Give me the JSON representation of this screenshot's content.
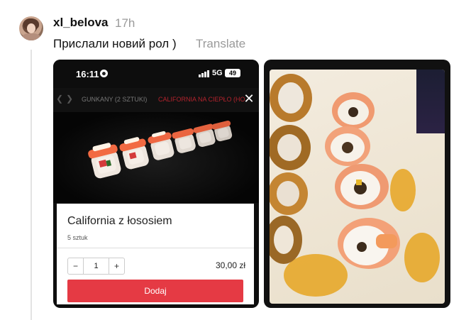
{
  "post": {
    "username": "xl_belova",
    "time": "17h",
    "caption": "Прислали новий рол )",
    "translate_label": "Translate"
  },
  "phone_screenshot": {
    "status_time": "16:11",
    "network": "5G",
    "battery": "49",
    "tabs": [
      "GUNKANY (2 SZTUKI)",
      "CALIFORNIA NA CIEPŁO (HO"
    ],
    "close_icon": "close-icon",
    "item_title": "California z łososiem",
    "item_subtitle": "5 sztuk",
    "quantity": "1",
    "minus_label": "−",
    "plus_label": "+",
    "price": "30,00 zł",
    "add_label": "Dodaj"
  },
  "colors": {
    "accent": "#e53a44",
    "active_tab": "#b2232d"
  }
}
